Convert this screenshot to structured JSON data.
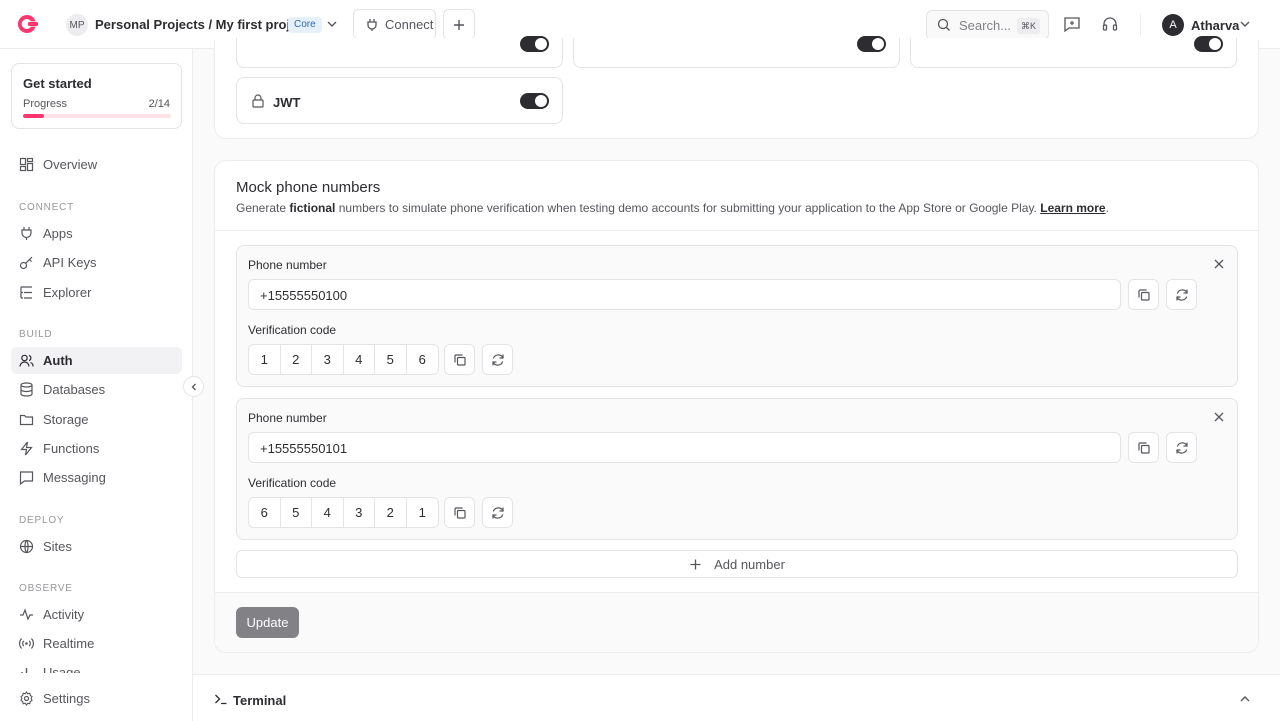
{
  "header": {
    "project_initials": "MP",
    "project_path": "Personal Projects / My first project",
    "plan_badge": "Core",
    "connect_label": "Connect",
    "search_placeholder": "Search...",
    "search_shortcut": "⌘K",
    "user_initial": "A",
    "user_name": "Atharva"
  },
  "sidebar": {
    "get_started": {
      "title": "Get started",
      "progress_label": "Progress",
      "progress_count": "2/14",
      "progress_fraction": 0.1429
    },
    "overview": "Overview",
    "sections": {
      "connect": "CONNECT",
      "build": "BUILD",
      "deploy": "DEPLOY",
      "observe": "OBSERVE"
    },
    "items": {
      "apps": "Apps",
      "api_keys": "API Keys",
      "explorer": "Explorer",
      "auth": "Auth",
      "databases": "Databases",
      "storage": "Storage",
      "functions": "Functions",
      "messaging": "Messaging",
      "sites": "Sites",
      "activity": "Activity",
      "realtime": "Realtime",
      "usage": "Usage"
    },
    "settings": "Settings"
  },
  "security": {
    "jwt_label": "JWT",
    "jwt_enabled": true
  },
  "mock_numbers": {
    "title": "Mock phone numbers",
    "desc_prefix": "Generate ",
    "desc_bold": "fictional",
    "desc_middle": " numbers to simulate phone verification when testing demo accounts for submitting your application to the App Store or Google Play. ",
    "desc_link": "Learn more",
    "desc_suffix": ".",
    "phone_label": "Phone number",
    "code_label": "Verification code",
    "entries": [
      {
        "phone": "+15555550100",
        "code": [
          "1",
          "2",
          "3",
          "4",
          "5",
          "6"
        ]
      },
      {
        "phone": "+15555550101",
        "code": [
          "6",
          "5",
          "4",
          "3",
          "2",
          "1"
        ]
      }
    ],
    "add_label": "Add number",
    "update_label": "Update"
  },
  "terminal": {
    "label": "Terminal"
  },
  "colors": {
    "accent": "#fd366e",
    "toggle_on": "#2d2d31"
  }
}
